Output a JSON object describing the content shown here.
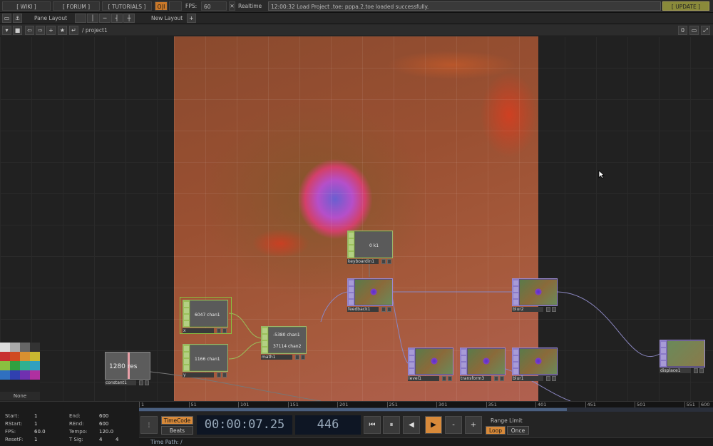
{
  "topbar": {
    "wiki": "[ WIKI ]",
    "forum": "[ FORUM ]",
    "tutorials": "[ TUTORIALS ]",
    "io_label": "O|I",
    "fps_label": "FPS:",
    "fps_value": "60",
    "realtime_label": "Realtime",
    "status_message": "12:00:32 Load Project .toe: pppa.2.toe loaded successfully.",
    "update": "[ UPDATE ]"
  },
  "bar2": {
    "pane_layout": "Pane Layout",
    "new_layout": "New Layout"
  },
  "bar3": {
    "path": "/ project1",
    "right_count": "0"
  },
  "nodes": [
    {
      "name": "keyboardin1",
      "val1": "0 k1"
    },
    {
      "name": "feedback1"
    },
    {
      "name": "blur2"
    },
    {
      "name": "x",
      "val1": "6047 chan1"
    },
    {
      "name": "math1",
      "val1": "-5380 chan1",
      "val2": "37114 chan2"
    },
    {
      "name": "y",
      "val1": "1166 chan1"
    },
    {
      "name": "constant1",
      "val1": "1280 res"
    },
    {
      "name": "level1"
    },
    {
      "name": "transform3"
    },
    {
      "name": "blur1"
    },
    {
      "name": "displace1"
    }
  ],
  "palette": {
    "none_label": "None"
  },
  "timeline": {
    "ticks": [
      "1",
      "51",
      "101",
      "151",
      "201",
      "251",
      "301",
      "351",
      "401",
      "451",
      "501",
      "551",
      "600"
    ],
    "progress": 0.745
  },
  "info": {
    "start_label": "Start:",
    "start": "1",
    "end_label": "End:",
    "end": "600",
    "rstart_label": "RStart:",
    "rstart": "1",
    "rend_label": "REnd:",
    "rend": "600",
    "fps_label": "FPS:",
    "fps": "60.0",
    "tempo_label": "Tempo:",
    "tempo": "120.0",
    "resetf_label": "ResetF:",
    "resetf": "1",
    "tsig_label": "T Sig:",
    "tsig_a": "4",
    "tsig_b": "4"
  },
  "transport": {
    "timecode_btn": "TimeCode",
    "beats_btn": "Beats",
    "timecode": "00:00:07.25",
    "frame": "446",
    "range_limit": "Range Limit",
    "loop": "Loop",
    "once": "Once",
    "minus": "-",
    "plus": "+",
    "time_path": "Time Path: /"
  },
  "colors": {
    "accent_orange": "#d88a3a",
    "top_node": "#8a7ac8",
    "chop_node": "#9ac05a"
  }
}
